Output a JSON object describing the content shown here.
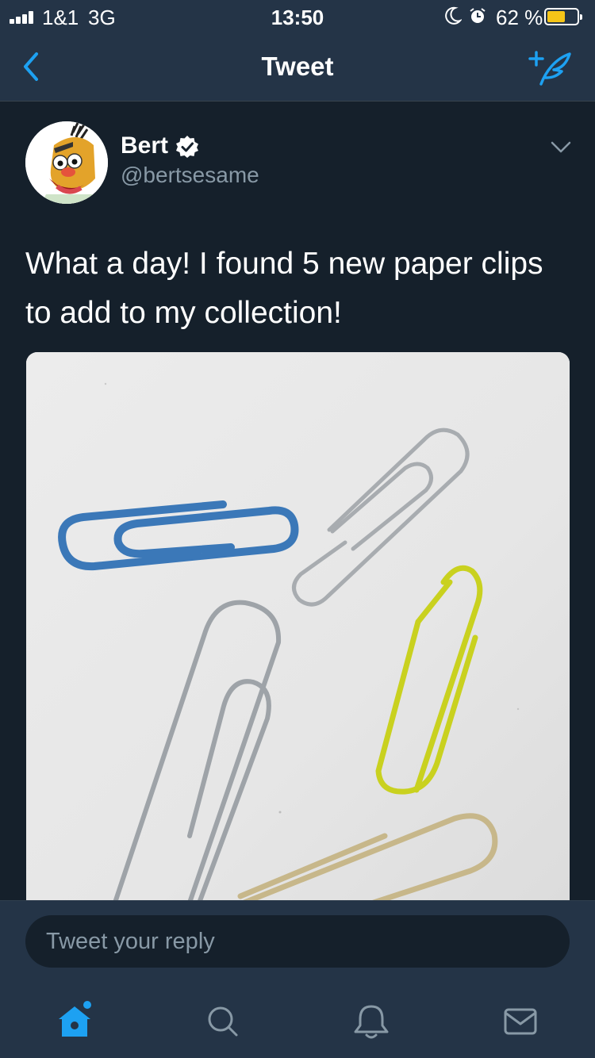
{
  "status_bar": {
    "carrier": "1&1",
    "network": "3G",
    "time": "13:50",
    "battery_percent": "62 %",
    "battery_level": 0.62
  },
  "nav": {
    "title": "Tweet",
    "back_icon": "chevron-left-icon",
    "compose_icon": "compose-tweet-icon"
  },
  "tweet": {
    "author_name": "Bert",
    "verified": true,
    "handle": "@bertsesame",
    "text": "What a day! I found 5 new paper clips to add to my collection!"
  },
  "reply": {
    "placeholder": "Tweet your reply"
  },
  "tabs": [
    {
      "name": "home",
      "icon": "home-icon",
      "active": true
    },
    {
      "name": "search",
      "icon": "search-icon",
      "active": false
    },
    {
      "name": "notifications",
      "icon": "bell-icon",
      "active": false
    },
    {
      "name": "messages",
      "icon": "mail-icon",
      "active": false
    }
  ],
  "colors": {
    "background": "#15202b",
    "bar": "#243447",
    "accent": "#1da1f2",
    "secondary_text": "#8899a6",
    "battery": "#f5c518"
  }
}
